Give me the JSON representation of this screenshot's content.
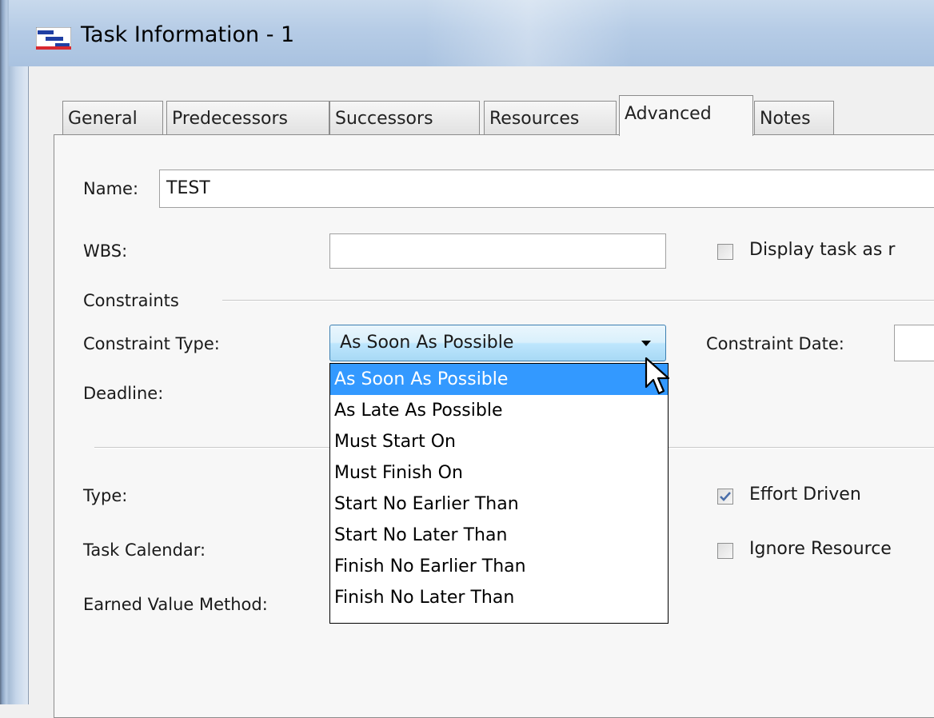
{
  "window": {
    "title": "Task Information - 1"
  },
  "tabs": [
    {
      "label": "General",
      "active": false
    },
    {
      "label": "Predecessors",
      "active": false
    },
    {
      "label": "Successors",
      "active": false
    },
    {
      "label": "Resources",
      "active": false
    },
    {
      "label": "Advanced",
      "active": true
    },
    {
      "label": "Notes",
      "active": false
    }
  ],
  "form": {
    "name_label": "Name:",
    "name_value": "TEST",
    "wbs_label": "WBS:",
    "wbs_value": "",
    "display_task_label": "Display task as r",
    "display_task_checked": false,
    "constraints_group": "Constraints",
    "constraint_type_label": "Constraint Type:",
    "constraint_type_value": "As Soon As Possible",
    "constraint_date_label": "Constraint Date:",
    "deadline_label": "Deadline:",
    "type_label": "Type:",
    "effort_driven_label": "Effort Driven",
    "effort_driven_checked": true,
    "task_calendar_label": "Task Calendar:",
    "ignore_resource_label": "Ignore Resource",
    "ignore_resource_checked": false,
    "earned_value_label": "Earned Value Method:"
  },
  "dropdown": {
    "selected_index": 0,
    "options": [
      "As Soon As Possible",
      "As Late As Possible",
      "Must Start On",
      "Must Finish On",
      "Start No Earlier Than",
      "Start No Later Than",
      "Finish No Earlier Than",
      "Finish No Later Than"
    ]
  },
  "colors": {
    "titlebar": "#b6cce6",
    "selection": "#3399ff",
    "checkbox_check": "#4a6ea9"
  }
}
